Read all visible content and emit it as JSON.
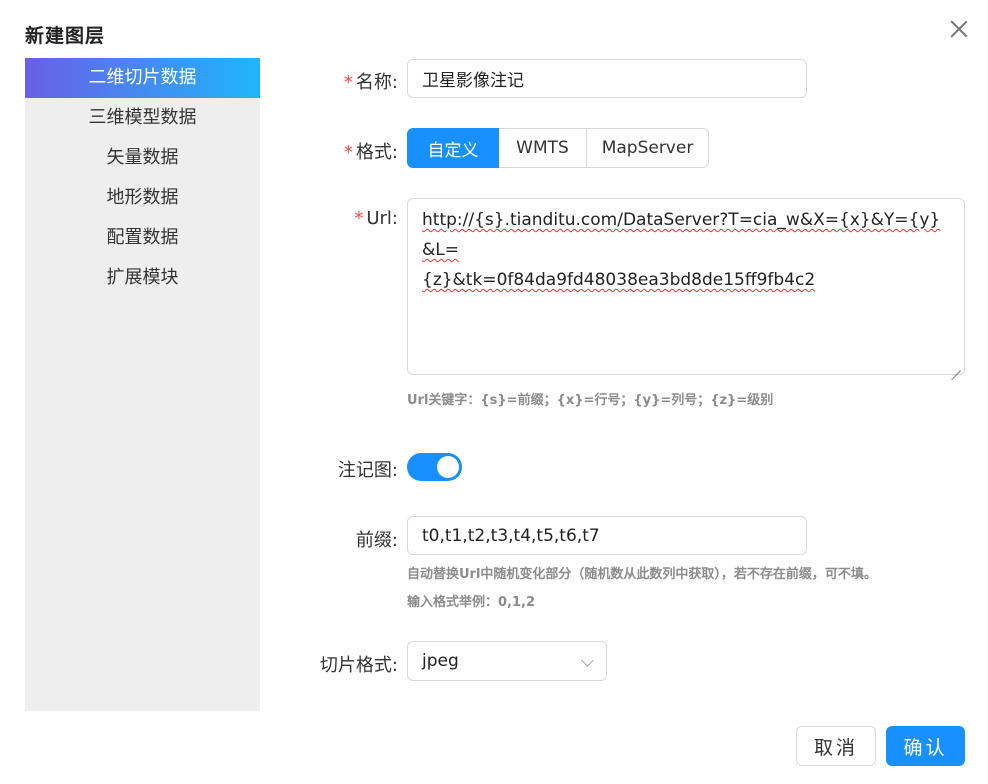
{
  "dialog": {
    "title": "新建图层"
  },
  "sidebar": {
    "items": [
      {
        "label": "二维切片数据"
      },
      {
        "label": "三维模型数据"
      },
      {
        "label": "矢量数据"
      },
      {
        "label": "地形数据"
      },
      {
        "label": "配置数据"
      },
      {
        "label": "扩展模块"
      }
    ],
    "active_index": 0
  },
  "form": {
    "required_mark": "*",
    "name": {
      "label": "名称:",
      "value": "卫星影像注记"
    },
    "format": {
      "label": "格式:",
      "options": [
        "自定义",
        "WMTS",
        "MapServer"
      ],
      "selected": "自定义"
    },
    "url": {
      "label": "Url:",
      "value_part1": "http://{s}.tianditu.com/DataServer?T=cia_w&X={x}&Y={y}&L=",
      "value_part2": "{z}&tk=0f84da9fd48038ea3bd8de15ff9fb4c2",
      "hint": "Url关键字：{s}=前缀；{x}=行号；{y}=列号；{z}=级别"
    },
    "annotation": {
      "label": "注记图:",
      "enabled": true
    },
    "prefix": {
      "label": "前缀:",
      "value": "t0,t1,t2,t3,t4,t5,t6,t7",
      "hint1": "自动替换Url中随机变化部分（随机数从此数列中获取），若不存在前缀，可不填。",
      "hint2": "输入格式举例：0,1,2"
    },
    "tile_format": {
      "label": "切片格式:",
      "value": "jpeg"
    }
  },
  "footer": {
    "cancel_label": "取消",
    "ok_label": "确认"
  },
  "colors": {
    "primary": "#1890ff",
    "required": "#f04848",
    "sidebar_bg": "#eeeeee"
  }
}
